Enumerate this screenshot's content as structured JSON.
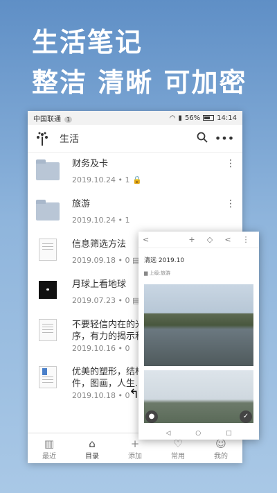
{
  "promo": {
    "line1": "生活笔记",
    "line2": "整洁 清晰 可加密"
  },
  "status": {
    "carrier": "中国联通",
    "carrier_badge": "1",
    "battery": "56%",
    "time": "14:14"
  },
  "appbar": {
    "title": "生活",
    "search_icon": "search-icon",
    "more_icon": "more-icon"
  },
  "items": [
    {
      "name": "财务及卡",
      "meta": "2019.10.24 • 1 🔒"
    },
    {
      "name": "旅游",
      "meta": "2019.10.24 • 1"
    },
    {
      "name": "信息筛选方法",
      "meta": "2019.09.18 • 0 ▤"
    },
    {
      "name": "月球上看地球",
      "meta": "2019.07.23 • 0 ▤"
    },
    {
      "name": "不要轻信内在的光序，有力的揭示和",
      "meta": "2019.10.16 • 0"
    },
    {
      "name": "优美的塑形，结构件，图画，人生...",
      "meta": "2019.10.18 • 0"
    }
  ],
  "tabs": [
    {
      "label": "最近",
      "icon": "▥"
    },
    {
      "label": "目录",
      "icon": "⌂"
    },
    {
      "label": "添加",
      "icon": "+"
    },
    {
      "label": "常用",
      "icon": "♡"
    },
    {
      "label": "我的",
      "icon": "☺"
    }
  ],
  "detail": {
    "title": "清远 2019.10",
    "sub": "▆ 上级:旅游",
    "toolbar": {
      "back": "<",
      "add": "+",
      "tag": "◇",
      "share": "<",
      "more": "⋮"
    },
    "nav": {
      "back": "◁",
      "home": "○",
      "recent": "□"
    }
  }
}
